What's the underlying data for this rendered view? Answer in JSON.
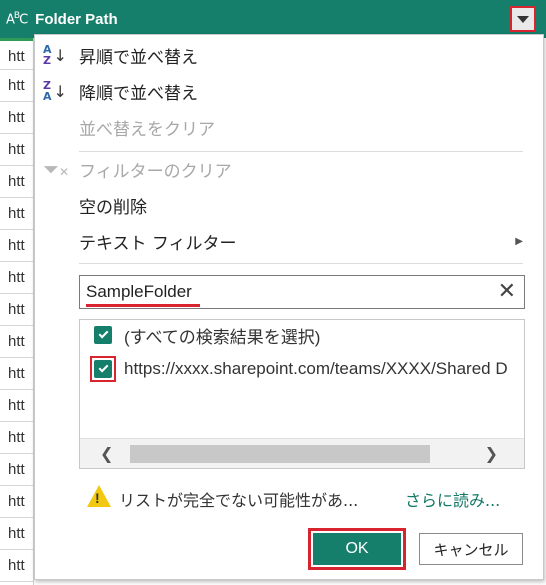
{
  "column_header": {
    "type_icon": "ABC",
    "title": "Folder Path",
    "dropdown_icon": "chevron-down-icon"
  },
  "column_cells": [
    "htt",
    "htt",
    "htt",
    "htt",
    "htt",
    "htt",
    "htt",
    "htt",
    "htt",
    "htt",
    "htt",
    "htt",
    "htt",
    "htt",
    "htt",
    "htt",
    "htt"
  ],
  "menu": {
    "sort_ascending": "昇順で並べ替え",
    "sort_descending": "降順で並べ替え",
    "clear_sort": "並べ替えをクリア",
    "clear_filter": "フィルターのクリア",
    "remove_empty": "空の削除",
    "text_filter": "テキスト フィルター"
  },
  "search": {
    "value": "SampleFolder"
  },
  "results": {
    "select_all": "(すべての検索結果を選択)",
    "item_1": "https://xxxx.sharepoint.com/teams/XXXX/Shared D"
  },
  "warning": {
    "text": "リストが完全でない可能性があ...",
    "link": "さらに読み..."
  },
  "buttons": {
    "ok": "OK",
    "cancel": "キャンセル"
  },
  "colors": {
    "header_bg": "#157f6b",
    "accent": "#157f6b",
    "highlight": "#d8242e",
    "warning": "#f2c811"
  }
}
